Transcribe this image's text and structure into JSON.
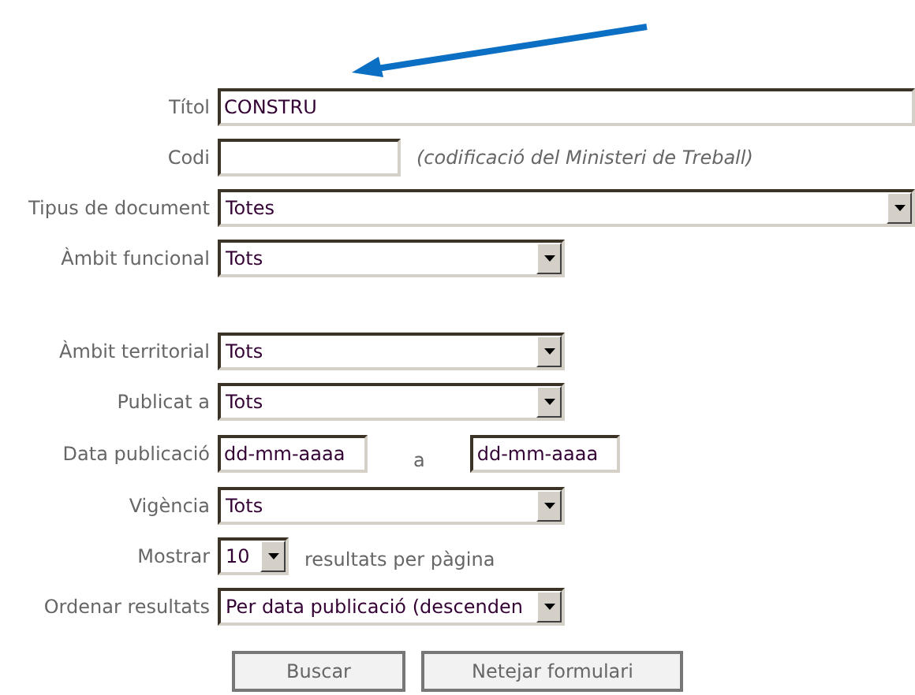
{
  "field_groups": [
    [
      {
        "label": "Títol",
        "kind": "widetext",
        "value": "CONSTRU"
      },
      {
        "label": "Codi",
        "kind": "shorttext",
        "note": "(codificació del Ministeri de Treball)"
      },
      {
        "label": "Tipus de document",
        "kind": "wideselect",
        "value": "Totes"
      },
      {
        "label": "Àmbit funcional",
        "kind": "select",
        "value": "Tots"
      }
    ],
    [
      {
        "label": "Àmbit territorial",
        "kind": "select",
        "value": "Tots"
      },
      {
        "label": "Publicat a",
        "kind": "select",
        "value": "Tots"
      },
      {
        "label": "Data publicació",
        "kind": "daterange",
        "from": "dd-mm-aaaa",
        "separator": "a",
        "to": "dd-mm-aaaa"
      },
      {
        "label": "Vigència",
        "kind": "select",
        "value": "Tots"
      },
      {
        "label": "Mostrar",
        "kind": "numberselect",
        "value": "10",
        "note": "resultats per pàgina"
      },
      {
        "label": "Ordenar resultats",
        "kind": "select",
        "value": "Per data publicació (descenden"
      }
    ]
  ],
  "buttons": [
    "Buscar",
    "Netejar formulari"
  ]
}
